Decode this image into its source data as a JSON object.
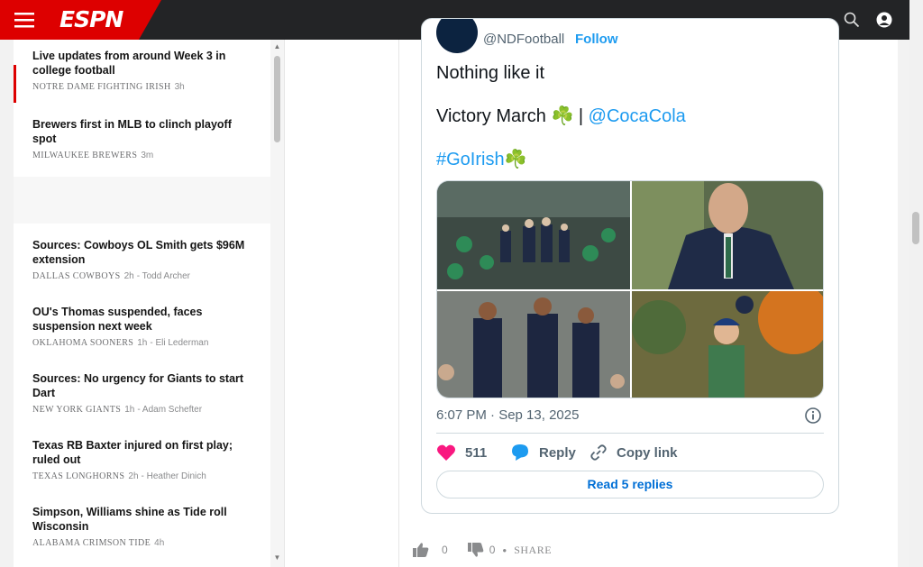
{
  "header": {
    "logo_text": "ESPN",
    "menu_icon": "hamburger-menu-icon",
    "search_icon": "search-icon",
    "profile_icon": "user-profile-icon"
  },
  "sidebar": {
    "items": [
      {
        "headline": "Live updates from around Week 3 in college football",
        "team": "Notre Dame Fighting Irish",
        "time": "3h",
        "author": ""
      },
      {
        "headline": "Brewers first in MLB to clinch playoff spot",
        "team": "Milwaukee Brewers",
        "time": "3m",
        "author": ""
      },
      {
        "headline": "Sources: Cowboys OL Smith gets $96M extension",
        "team": "Dallas Cowboys",
        "time": "2h",
        "author": "- Todd Archer"
      },
      {
        "headline": "OU's Thomas suspended, faces suspension next week",
        "team": "Oklahoma Sooners",
        "time": "1h",
        "author": "- Eli Lederman"
      },
      {
        "headline": "Sources: No urgency for Giants to start Dart",
        "team": "New York Giants",
        "time": "1h",
        "author": "- Adam Schefter"
      },
      {
        "headline": "Texas RB Baxter injured on first play; ruled out",
        "team": "Texas Longhorns",
        "time": "2h",
        "author": "- Heather Dinich"
      },
      {
        "headline": "Simpson, Williams shine as Tide roll Wisconsin",
        "team": "Alabama Crimson Tide",
        "time": "4h",
        "author": ""
      }
    ]
  },
  "tweet": {
    "handle": "@NDFootball",
    "follow_label": "Follow",
    "line1": "Nothing like it",
    "line2_text": "Victory March ☘️ | ",
    "line2_link": "@CocaCola",
    "hashtag": "#GoIrish☘️",
    "timestamp": "6:07 PM · Sep 13, 2025",
    "likes": "511",
    "reply_label": "Reply",
    "copy_link_label": "Copy link",
    "read_replies_label": "Read 5 replies"
  },
  "votes": {
    "up_count": "0",
    "down_count": "0",
    "share_label": "SHARE"
  },
  "colors": {
    "espn_red": "#dd0000",
    "topbar": "#232426",
    "link_blue": "#1d9bf0",
    "like_pink": "#f91880"
  }
}
